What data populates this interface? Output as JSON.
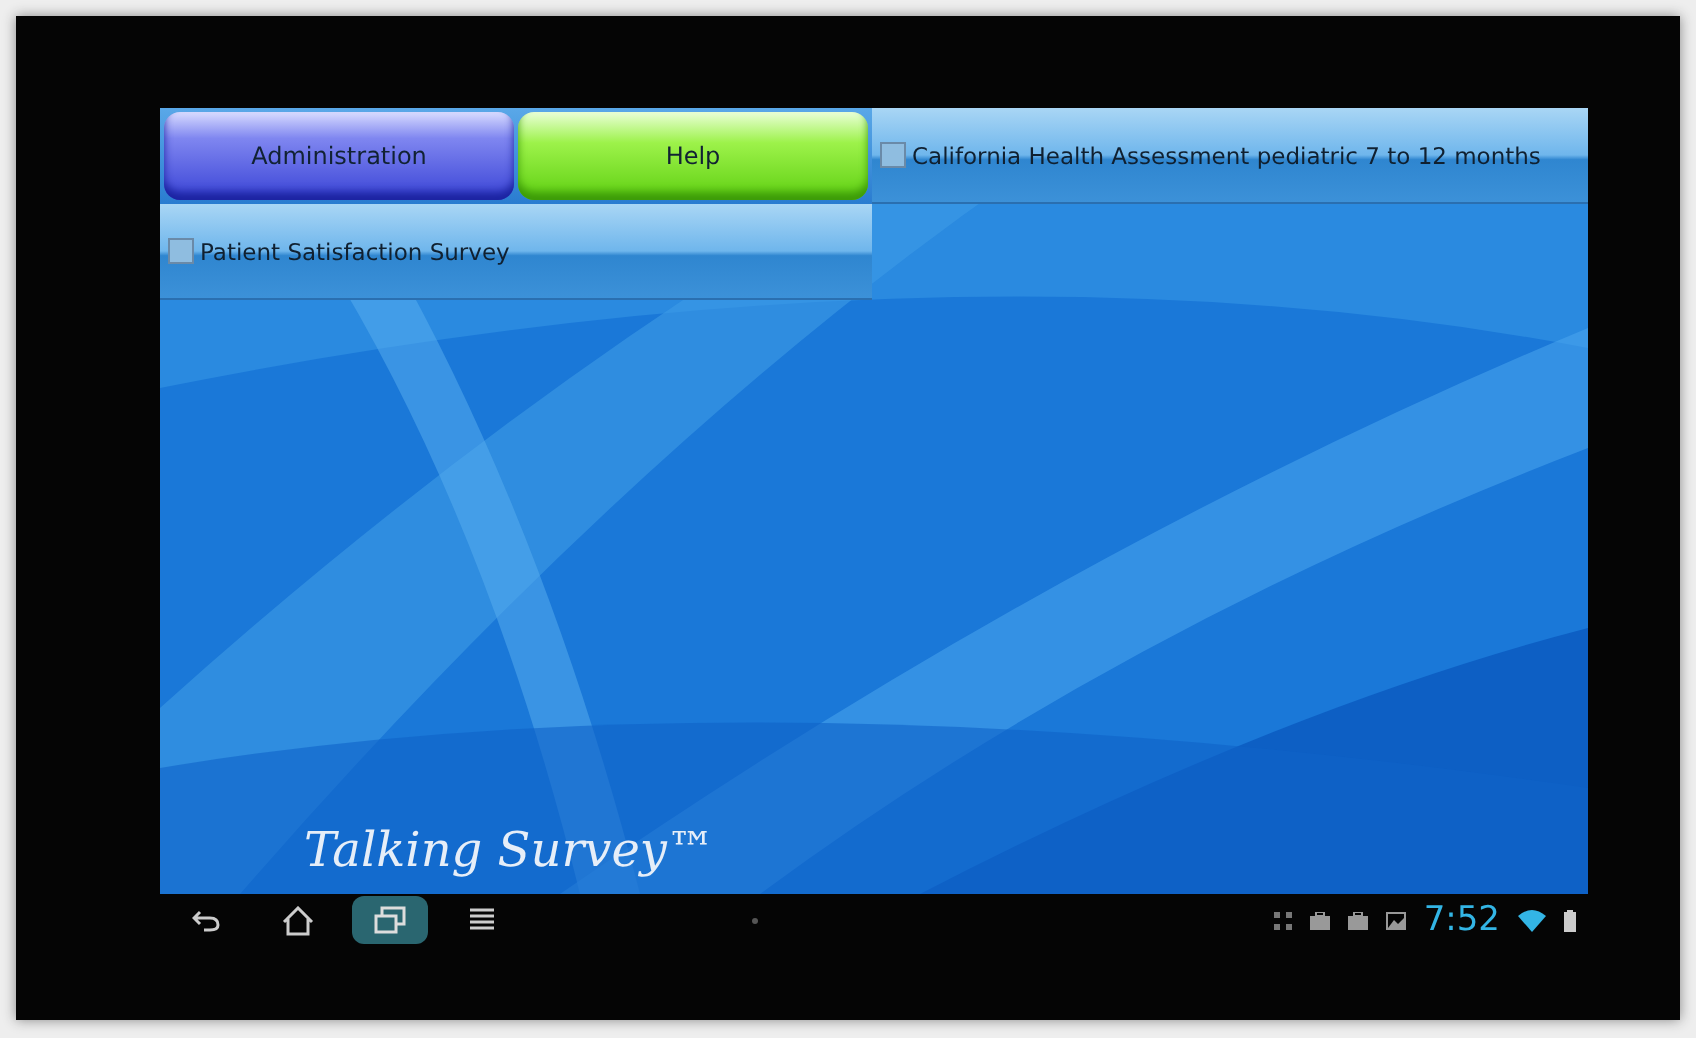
{
  "buttons": [
    {
      "label": "Administration",
      "kind": "admin"
    },
    {
      "label": "Help",
      "kind": "help"
    }
  ],
  "surveys": [
    {
      "label": "California Health Assessment pediatric 7 to 12 months",
      "checked": false
    },
    {
      "label": "Patient Satisfaction Survey",
      "checked": false
    }
  ],
  "app_title": "Talking Survey™",
  "nav_bar": {
    "buttons": [
      {
        "kind": "back",
        "selected": false
      },
      {
        "kind": "home",
        "selected": false
      },
      {
        "kind": "recents",
        "selected": true
      },
      {
        "kind": "menu",
        "selected": false
      }
    ],
    "time": "7:52"
  }
}
